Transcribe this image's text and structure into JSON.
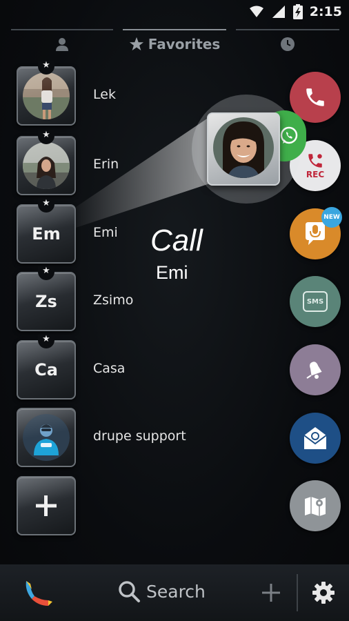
{
  "status_bar": {
    "time": "2:15"
  },
  "tabs": [
    {
      "icon": "person-icon",
      "label": ""
    },
    {
      "icon": "star-icon",
      "label": "Favorites"
    },
    {
      "icon": "clock-icon",
      "label": ""
    }
  ],
  "contacts": [
    {
      "name": "Lek",
      "initials": "",
      "favorite": true
    },
    {
      "name": "Erin",
      "initials": "",
      "favorite": true
    },
    {
      "name": "Emi",
      "initials": "Em",
      "favorite": true
    },
    {
      "name": "Zsimo",
      "initials": "Zs",
      "favorite": true
    },
    {
      "name": "Casa",
      "initials": "Ca",
      "favorite": true
    },
    {
      "name": "drupe support",
      "initials": "",
      "favorite": false
    }
  ],
  "add_tile": {
    "icon": "plus-icon"
  },
  "actions": [
    {
      "name": "call",
      "icon": "phone-icon",
      "color": "#b8404c",
      "label": ""
    },
    {
      "name": "call-recorder",
      "icon": "phone-rec-icon",
      "color": "#e8e8ea",
      "label": "REC"
    },
    {
      "name": "voice-message",
      "icon": "microphone-icon",
      "color": "#d98a2a",
      "label": "",
      "badge": "NEW"
    },
    {
      "name": "sms",
      "icon": "sms-icon",
      "color": "#5a8478",
      "label": "SMS"
    },
    {
      "name": "reminder",
      "icon": "bell-icon",
      "color": "#8d7d96",
      "label": ""
    },
    {
      "name": "email",
      "icon": "email-icon",
      "color": "#1e4f86",
      "label": ""
    },
    {
      "name": "navigate",
      "icon": "map-icon",
      "color": "#8f9498",
      "label": ""
    }
  ],
  "whatsapp": {
    "icon": "whatsapp-icon",
    "color": "#3fae4a"
  },
  "drag_hint": {
    "action": "Call",
    "target": "Emi"
  },
  "bottom_bar": {
    "search_label": "Search"
  },
  "colors": {
    "background": "#0b0d10",
    "accent_call": "#b8404c"
  }
}
